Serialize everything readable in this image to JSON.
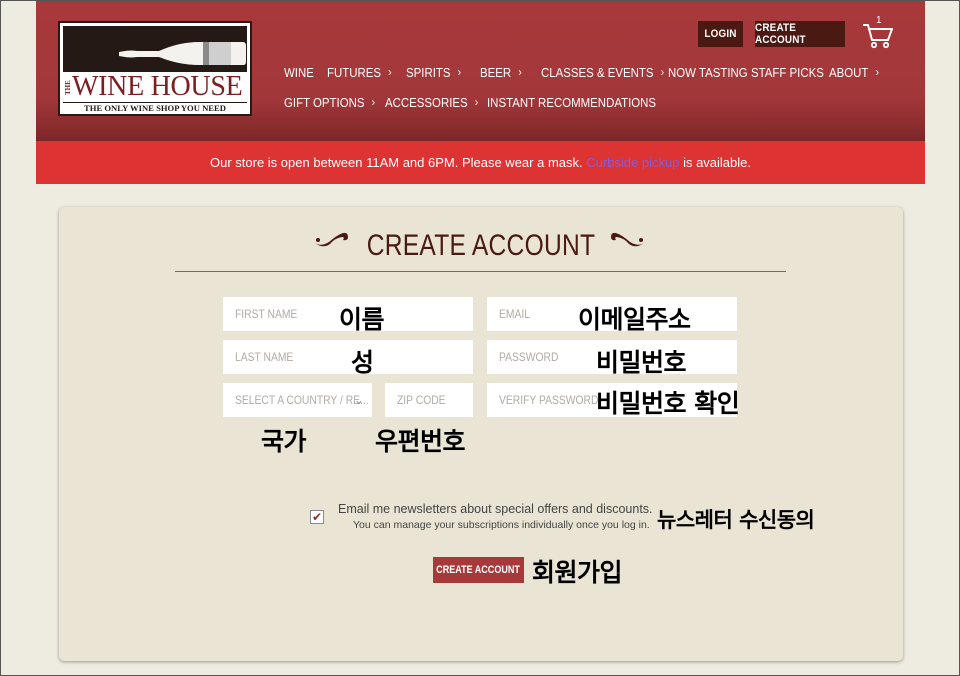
{
  "header": {
    "logo": {
      "the": "THE",
      "name": "WINE HOUSE",
      "tagline": "THE ONLY WINE SHOP YOU NEED"
    },
    "login_label": "LOGIN",
    "create_account_label": "CREATE ACCOUNT",
    "cart_count": "1",
    "nav_row1": [
      {
        "label": "WINE",
        "chevron": false
      },
      {
        "label": "FUTURES",
        "chevron": true
      },
      {
        "label": "SPIRITS",
        "chevron": true
      },
      {
        "label": "BEER",
        "chevron": true
      },
      {
        "label": "CLASSES & EVENTS",
        "chevron": true
      },
      {
        "label": "NOW TASTING",
        "chevron": false
      },
      {
        "label": "STAFF PICKS",
        "chevron": false
      },
      {
        "label": "ABOUT",
        "chevron": true
      }
    ],
    "nav_row2": [
      {
        "label": "GIFT OPTIONS",
        "chevron": true
      },
      {
        "label": "ACCESSORIES",
        "chevron": true
      },
      {
        "label": "INSTANT RECOMMENDATIONS",
        "chevron": false
      }
    ]
  },
  "banner": {
    "before": "Our store is open between 11AM and 6PM. Please wear a mask. ",
    "link": "Curbside pickup",
    "after": " is available."
  },
  "form": {
    "title": "CREATE ACCOUNT",
    "first_name_placeholder": "FIRST NAME",
    "last_name_placeholder": "LAST NAME",
    "country_placeholder": "SELECT A COUNTRY / RE...",
    "zip_placeholder": "ZIP CODE",
    "email_placeholder": "EMAIL",
    "password_placeholder": "PASSWORD",
    "verify_password_placeholder": "VERIFY PASSWORD",
    "newsletter_label": "Email me newsletters about special offers and discounts.",
    "newsletter_sub": "You can manage your subscriptions individually once you log in.",
    "newsletter_checked": true,
    "submit_label": "CREATE ACCOUNT"
  },
  "annotations": {
    "first_name": "이름",
    "last_name": "성",
    "email": "이메일주소",
    "password": "비밀번호",
    "verify_password": "비밀번호 확인",
    "country": "국가",
    "zip": "우편번호",
    "newsletter": "뉴스레터 수신동의",
    "submit": "회원가입"
  },
  "colors": {
    "header": "#a2373a",
    "banner": "#dd3332",
    "dark_button": "#4a1a12",
    "card": "#e9e4d4",
    "link": "#8a5cd6"
  }
}
